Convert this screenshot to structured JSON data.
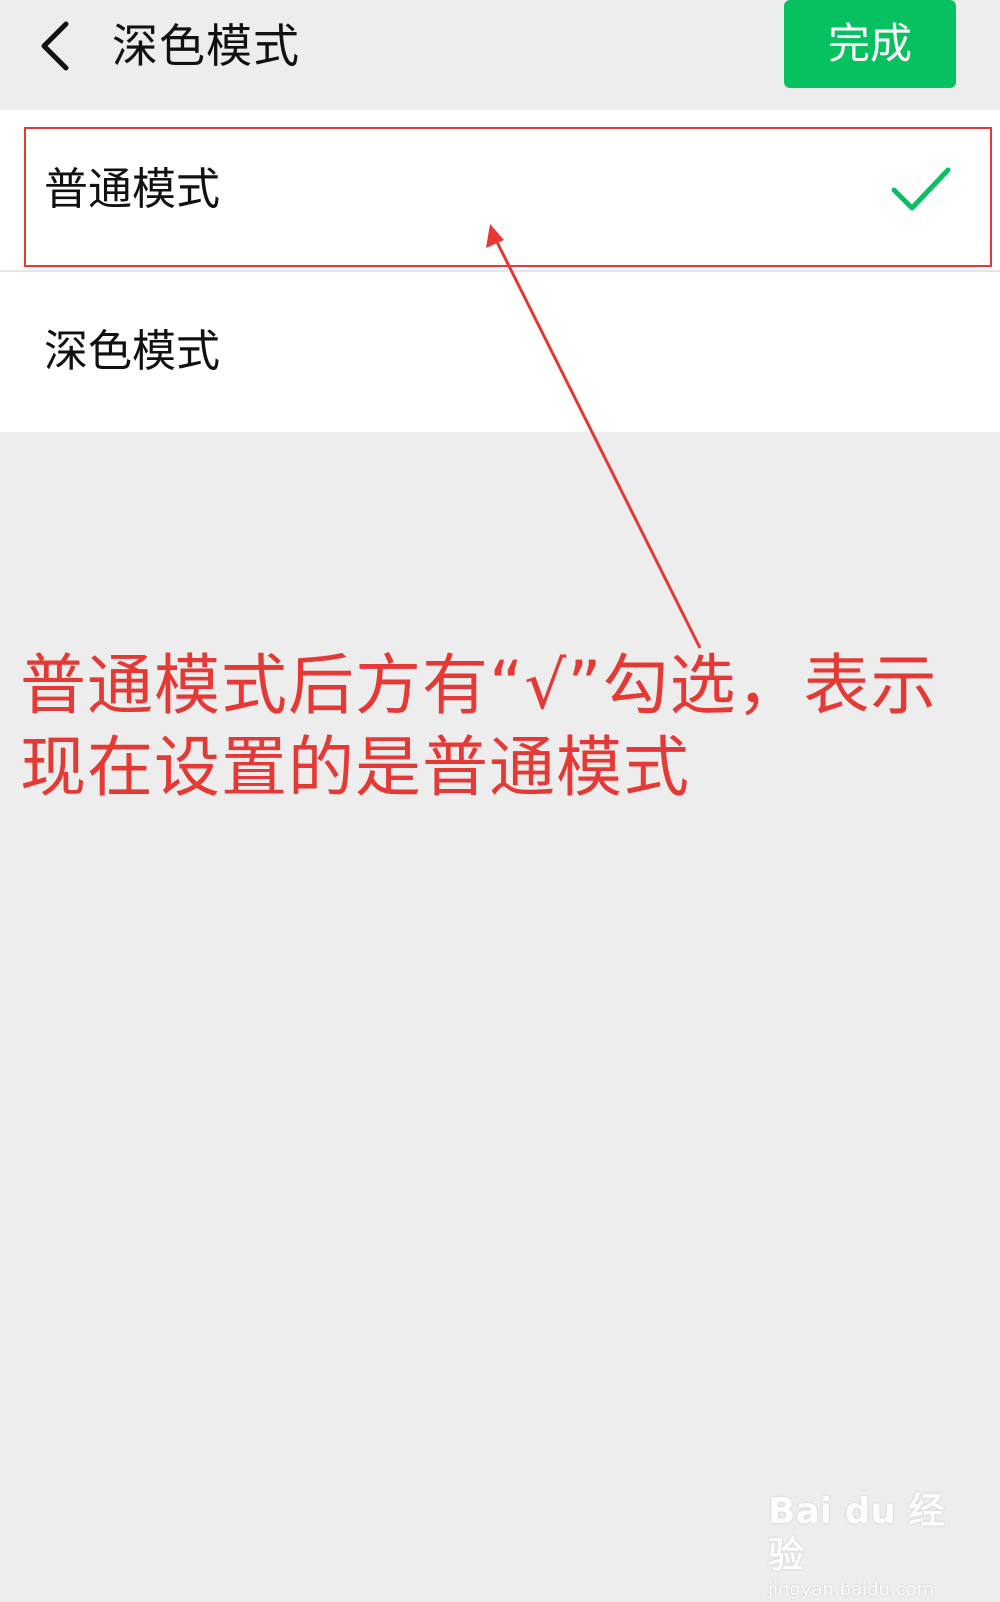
{
  "header": {
    "title": "深色模式",
    "done_label": "完成"
  },
  "options": [
    {
      "label": "普通模式",
      "selected": true
    },
    {
      "label": "深色模式",
      "selected": false
    }
  ],
  "annotation": {
    "text": "普通模式后方有“√”勾选，表示现在设置的是普通模式"
  },
  "watermark": {
    "logo": "Bai du 经验",
    "url": "jingyan.baidu.com"
  },
  "colors": {
    "accent": "#07c160",
    "annotation": "#e53935",
    "background": "#ededed"
  },
  "icons": {
    "back": "chevron-left-icon",
    "check": "checkmark-icon"
  }
}
